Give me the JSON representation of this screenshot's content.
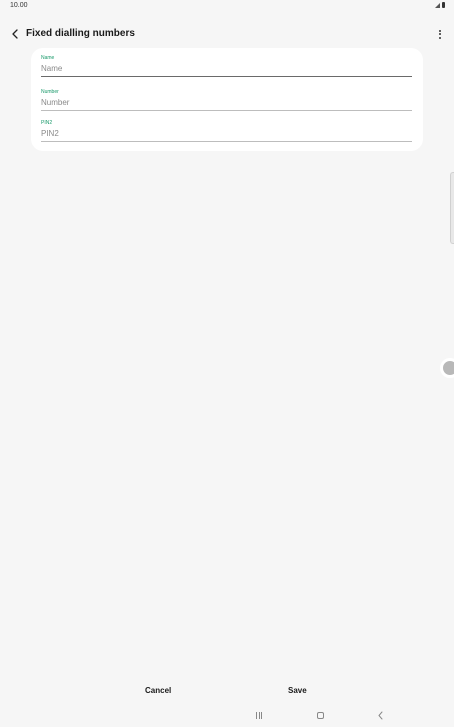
{
  "status_bar": {
    "time": "10.00"
  },
  "app_bar": {
    "title": "Fixed dialling numbers",
    "back_icon": "chevron-left-icon",
    "more_icon": "more-vertical-icon"
  },
  "form": {
    "fields": [
      {
        "label": "Name",
        "value": "",
        "placeholder": "Name"
      },
      {
        "label": "Number",
        "value": "",
        "placeholder": "Number"
      },
      {
        "label": "PIN2",
        "value": "",
        "placeholder": "PIN2"
      }
    ]
  },
  "actions": {
    "cancel_label": "Cancel",
    "save_label": "Save"
  },
  "colors": {
    "accent": "#1a9a6b",
    "background": "#f6f6f6",
    "card": "#ffffff"
  }
}
